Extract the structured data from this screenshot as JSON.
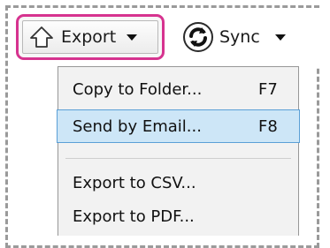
{
  "toolbar": {
    "export_label": "Export",
    "sync_label": "Sync"
  },
  "menu": {
    "items": [
      {
        "label": "Copy to Folder...",
        "shortcut": "F7"
      },
      {
        "label": "Send by Email...",
        "shortcut": "F8"
      },
      {
        "label": "Export to CSV...",
        "shortcut": ""
      },
      {
        "label": "Export to PDF...",
        "shortcut": ""
      }
    ],
    "highlighted_index": 1
  },
  "colors": {
    "export_outline": "#d6338f",
    "menu_highlight": "#cde6f7",
    "menu_highlight_border": "#5b9fd6",
    "sync_icon": "#1a1a1a"
  },
  "icons": {
    "export": "house-upload-icon",
    "sync": "sync-icon",
    "dropdown": "caret-down-icon"
  }
}
